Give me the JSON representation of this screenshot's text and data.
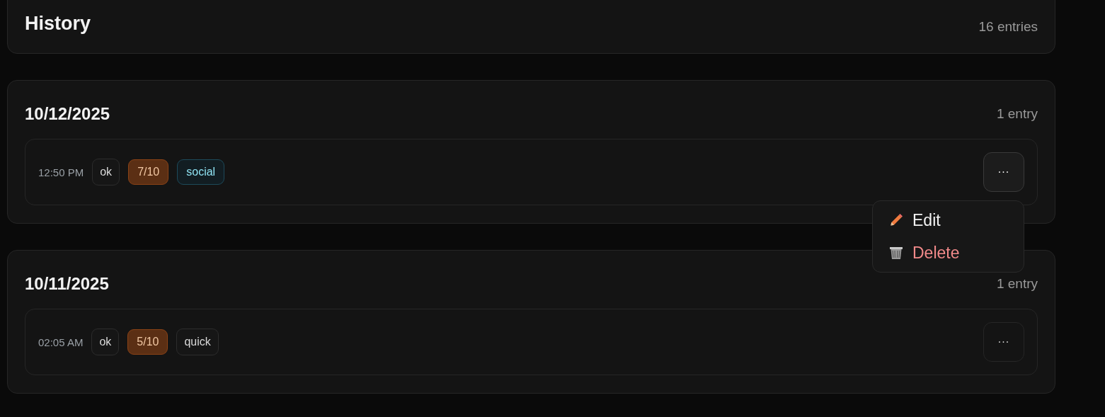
{
  "header": {
    "title": "History",
    "count": "16 entries"
  },
  "groups": [
    {
      "date": "10/12/2025",
      "count": "1 entry",
      "entries": [
        {
          "time": "12:50 PM",
          "tags": [
            {
              "label": "ok",
              "kind": "neutral"
            },
            {
              "label": "7/10",
              "kind": "score"
            },
            {
              "label": "social",
              "kind": "accent"
            }
          ],
          "menu_open": true
        }
      ]
    },
    {
      "date": "10/11/2025",
      "count": "1 entry",
      "entries": [
        {
          "time": "02:05 AM",
          "tags": [
            {
              "label": "ok",
              "kind": "neutral"
            },
            {
              "label": "5/10",
              "kind": "score"
            },
            {
              "label": "quick",
              "kind": "neutral"
            }
          ],
          "menu_open": false
        }
      ]
    }
  ],
  "menu_button": "···",
  "menu": [
    {
      "label": "Edit",
      "kind": "edit"
    },
    {
      "label": "Delete",
      "kind": "danger"
    }
  ]
}
